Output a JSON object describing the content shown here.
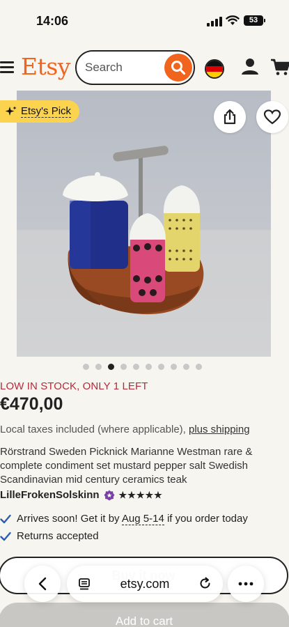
{
  "status_bar": {
    "time": "14:06",
    "battery": "53"
  },
  "header": {
    "logo": "Etsy",
    "search_placeholder": "Search"
  },
  "product_image": {
    "badge": "Etsy's Pick",
    "carousel_count": 10,
    "carousel_active": 2
  },
  "product": {
    "stock_notice": "LOW IN STOCK, ONLY 1 LEFT",
    "price": "€470,00",
    "taxes": "Local taxes included (where applicable),",
    "shipping_link": "plus shipping",
    "title": "Rörstrand Sweden Picknick Marianne Westman rare & complete condiment set mustard pepper salt Swedish Scandinavian mid century ceramics teak",
    "seller": "LilleFrokenSolskinn",
    "rating_stars": "★★★★★",
    "arrival_prefix": "Arrives soon! Get it by",
    "arrival_dates": "Aug 5-14",
    "arrival_suffix": "if you order today",
    "returns": "Returns accepted"
  },
  "actions": {
    "buy_label": "Buy it now",
    "add_to_cart": "Add to cart"
  },
  "browser": {
    "url": "etsy.com"
  },
  "colors": {
    "brand": "#f1641e",
    "stock": "#b32a3a",
    "badge": "#fbd34f"
  }
}
